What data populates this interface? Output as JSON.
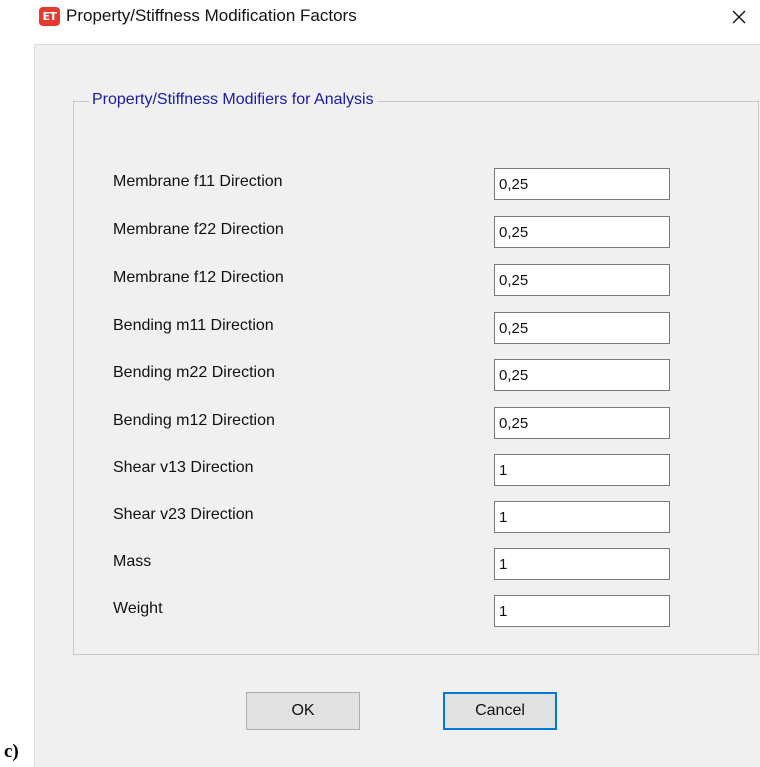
{
  "window": {
    "icon_text": "ET",
    "title": "Property/Stiffness Modification Factors",
    "close_symbol": "✕"
  },
  "group": {
    "legend": "Property/Stiffness Modifiers for Analysis",
    "fields": [
      {
        "label": "Membrane f11 Direction",
        "value": "0,25"
      },
      {
        "label": "Membrane f22 Direction",
        "value": "0,25"
      },
      {
        "label": "Membrane f12 Direction",
        "value": "0,25"
      },
      {
        "label": "Bending m11 Direction",
        "value": "0,25"
      },
      {
        "label": "Bending m22 Direction",
        "value": "0,25"
      },
      {
        "label": "Bending m12 Direction",
        "value": "0,25"
      },
      {
        "label": "Shear v13 Direction",
        "value": "1"
      },
      {
        "label": "Shear v23 Direction",
        "value": "1"
      },
      {
        "label": "Mass",
        "value": "1"
      },
      {
        "label": "Weight",
        "value": "1"
      }
    ]
  },
  "buttons": {
    "ok_label": "OK",
    "cancel_label": "Cancel"
  },
  "caption": "c)",
  "colors": {
    "icon_bg": "#e8392f",
    "legend_text": "#1a1aa6",
    "focus_border": "#0078d7",
    "dialog_bg": "#f0f0f0"
  }
}
